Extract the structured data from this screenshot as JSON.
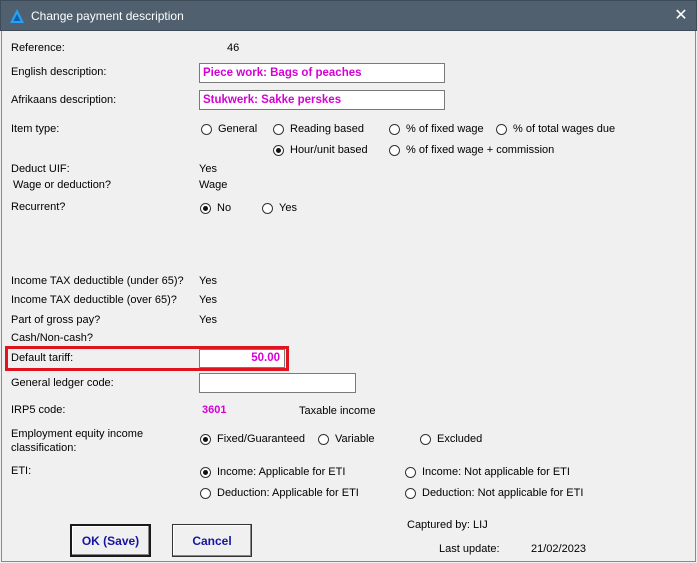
{
  "window": {
    "title": "Change payment description",
    "close_glyph": "✕"
  },
  "fields": {
    "reference_label": "Reference:",
    "reference_value": "46",
    "english_label": "English description:",
    "english_value": "Piece work: Bags of peaches",
    "afrikaans_label": "Afrikaans description:",
    "afrikaans_value": "Stukwerk: Sakke perskes",
    "item_type_label": "Item type:",
    "item_type_options": [
      "General",
      "Reading based",
      "% of fixed wage",
      "% of total wages due",
      "Hour/unit based",
      "% of fixed wage + commission"
    ],
    "item_type_selected": "Hour/unit based",
    "uif_label": "Deduct UIF:",
    "uif_value": "Yes",
    "wage_label": "Wage or deduction?",
    "wage_value": "Wage",
    "recurrent_label": "Recurrent?",
    "recurrent_options": [
      "No",
      "Yes"
    ],
    "recurrent_selected": "No",
    "tax_under_label": "Income TAX deductible (under 65)?",
    "tax_under_value": "Yes",
    "tax_over_label": "Income TAX deductible (over 65)?",
    "tax_over_value": "Yes",
    "gross_label": "Part of gross pay?",
    "gross_value": "Yes",
    "cash_label": "Cash/Non-cash?",
    "tariff_label": "Default tariff:",
    "tariff_value": "50.00",
    "gl_label": "General ledger code:",
    "gl_value": "",
    "irp5_label": "IRP5 code:",
    "irp5_code": "3601",
    "irp5_desc": "Taxable income",
    "ee_label_1": "Employment equity income",
    "ee_label_2": "classification:",
    "ee_options": [
      "Fixed/Guaranteed",
      "Variable",
      "Excluded"
    ],
    "ee_selected": "Fixed/Guaranteed",
    "eti_label": "ETI:",
    "eti_options": [
      "Income: Applicable for ETI",
      "Income: Not applicable for ETI",
      "Deduction: Applicable for ETI",
      "Deduction: Not applicable for ETI"
    ],
    "eti_selected": "Income: Applicable for ETI"
  },
  "footer": {
    "ok_label": "OK (Save)",
    "cancel_label": "Cancel",
    "captured_label": "Captured by: LIJ",
    "last_update_label": "Last update:",
    "last_update_value": "21/02/2023"
  },
  "colors": {
    "titlebar": "#50606f",
    "accent_text": "#d400d4",
    "highlight": "#e0141e",
    "button_text": "#1515a0"
  }
}
